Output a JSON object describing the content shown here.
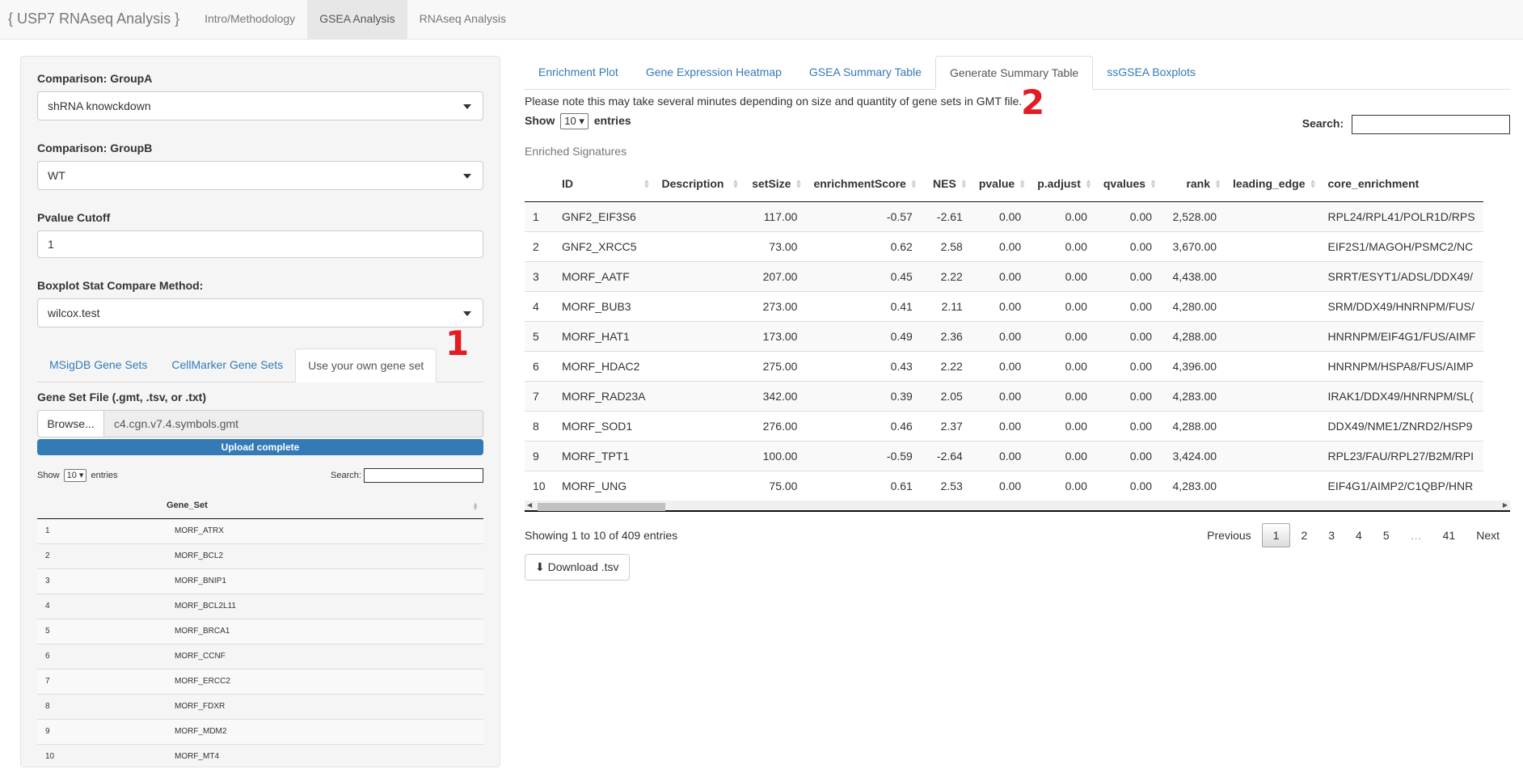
{
  "navbar": {
    "brand": "{ USP7 RNAseq Analysis }",
    "tabs": [
      "Intro/Methodology",
      "GSEA Analysis",
      "RNAseq Analysis"
    ],
    "active_tab": "GSEA Analysis"
  },
  "sidebar": {
    "groupA_label": "Comparison: GroupA",
    "groupA_value": "shRNA knowckdown",
    "groupB_label": "Comparison: GroupB",
    "groupB_value": "WT",
    "pvalue_label": "Pvalue Cutoff",
    "pvalue_value": "1",
    "boxplot_label": "Boxplot Stat Compare Method:",
    "boxplot_value": "wilcox.test",
    "gene_tabs": [
      "MSigDB Gene Sets",
      "CellMarker Gene Sets",
      "Use your own gene set"
    ],
    "marker_1": "1",
    "file_label": "Gene Set File (.gmt, .tsv, or .txt)",
    "browse_label": "Browse...",
    "file_name": "c4.cgn.v7.4.symbols.gmt",
    "upload_status": "Upload complete",
    "upload_progress": 1.0,
    "show_label": "Show",
    "show_value": "10",
    "entries_label": "entries",
    "search_label": "Search:",
    "table_header": "Gene_Set",
    "rows": [
      [
        "1",
        "MORF_ATRX"
      ],
      [
        "2",
        "MORF_BCL2"
      ],
      [
        "3",
        "MORF_BNIP1"
      ],
      [
        "4",
        "MORF_BCL2L11"
      ],
      [
        "5",
        "MORF_BRCA1"
      ],
      [
        "6",
        "MORF_CCNF"
      ],
      [
        "7",
        "MORF_ERCC2"
      ],
      [
        "8",
        "MORF_FDXR"
      ],
      [
        "9",
        "MORF_MDM2"
      ],
      [
        "10",
        "MORF_MT4"
      ]
    ]
  },
  "main": {
    "tabs": [
      "Enrichment Plot",
      "Gene Expression Heatmap",
      "GSEA Summary Table",
      "Generate Summary Table",
      "ssGSEA Boxplots"
    ],
    "active_tab": "Generate Summary Table",
    "note": "Please note this may take several minutes depending on size and quantity of gene sets in GMT file.",
    "marker_2": "2",
    "show_label": "Show",
    "show_value": "10",
    "entries_label": "entries",
    "search_label": "Search:",
    "caption": "Enriched Signatures",
    "columns": [
      "",
      "ID",
      "Description",
      "setSize",
      "enrichmentScore",
      "NES",
      "pvalue",
      "p.adjust",
      "qvalues",
      "rank",
      "leading_edge",
      "core_enrichment"
    ],
    "rows": [
      [
        "1",
        "GNF2_EIF3S6",
        "",
        "117.00",
        "-0.57",
        "-2.61",
        "0.00",
        "0.00",
        "0.00",
        "2,528.00",
        "",
        "RPL24/RPL41/POLR1D/RPS"
      ],
      [
        "2",
        "GNF2_XRCC5",
        "",
        "73.00",
        "0.62",
        "2.58",
        "0.00",
        "0.00",
        "0.00",
        "3,670.00",
        "",
        "EIF2S1/MAGOH/PSMC2/NC"
      ],
      [
        "3",
        "MORF_AATF",
        "",
        "207.00",
        "0.45",
        "2.22",
        "0.00",
        "0.00",
        "0.00",
        "4,438.00",
        "",
        "SRRT/ESYT1/ADSL/DDX49/"
      ],
      [
        "4",
        "MORF_BUB3",
        "",
        "273.00",
        "0.41",
        "2.11",
        "0.00",
        "0.00",
        "0.00",
        "4,280.00",
        "",
        "SRM/DDX49/HNRNPM/FUS/"
      ],
      [
        "5",
        "MORF_HAT1",
        "",
        "173.00",
        "0.49",
        "2.36",
        "0.00",
        "0.00",
        "0.00",
        "4,288.00",
        "",
        "HNRNPM/EIF4G1/FUS/AIMF"
      ],
      [
        "6",
        "MORF_HDAC2",
        "",
        "275.00",
        "0.43",
        "2.22",
        "0.00",
        "0.00",
        "0.00",
        "4,396.00",
        "",
        "HNRNPM/HSPA8/FUS/AIMP"
      ],
      [
        "7",
        "MORF_RAD23A",
        "",
        "342.00",
        "0.39",
        "2.05",
        "0.00",
        "0.00",
        "0.00",
        "4,283.00",
        "",
        "IRAK1/DDX49/HNRNPM/SL("
      ],
      [
        "8",
        "MORF_SOD1",
        "",
        "276.00",
        "0.46",
        "2.37",
        "0.00",
        "0.00",
        "0.00",
        "4,288.00",
        "",
        "DDX49/NME1/ZNRD2/HSP9"
      ],
      [
        "9",
        "MORF_TPT1",
        "",
        "100.00",
        "-0.59",
        "-2.64",
        "0.00",
        "0.00",
        "0.00",
        "3,424.00",
        "",
        "RPL23/FAU/RPL27/B2M/RPI"
      ],
      [
        "10",
        "MORF_UNG",
        "",
        "75.00",
        "0.61",
        "2.53",
        "0.00",
        "0.00",
        "0.00",
        "4,283.00",
        "",
        "EIF4G1/AIMP2/C1QBP/HNR"
      ]
    ],
    "info": "Showing 1 to 10 of 409 entries",
    "pager": [
      "Previous",
      "1",
      "2",
      "3",
      "4",
      "5",
      "…",
      "41",
      "Next"
    ],
    "active_page": "1",
    "download_label": "Download .tsv"
  }
}
